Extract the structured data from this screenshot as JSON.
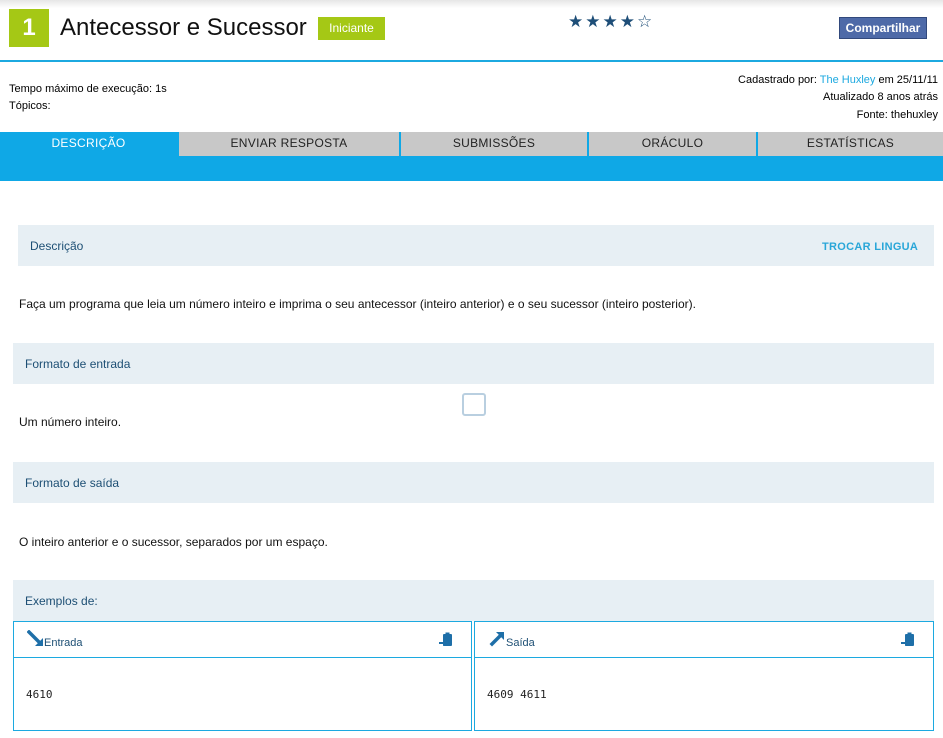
{
  "header": {
    "number": "1",
    "title": "Antecessor e Sucessor",
    "level": "Iniciante",
    "stars": "★★★★☆",
    "share_label": "Compartilhar"
  },
  "meta": {
    "time_limit": "Tempo máximo de execução: 1s",
    "topics": "Tópicos:",
    "registered_prefix": "Cadastrado por: ",
    "registered_by": "The Huxley",
    "registered_date": " em 25/11/11",
    "updated": "Atualizado 8 anos atrás",
    "source": "Fonte: thehuxley"
  },
  "tabs": [
    {
      "label": "DESCRIÇÃO",
      "active": true
    },
    {
      "label": "ENVIAR RESPOSTA",
      "active": false
    },
    {
      "label": "SUBMISSÕES",
      "active": false
    },
    {
      "label": "ORÁCULO",
      "active": false
    },
    {
      "label": "ESTATÍSTICAS",
      "active": false
    }
  ],
  "description": {
    "title": "Descrição",
    "switch_language": "TROCAR LINGUA",
    "text": "Faça um programa que leia um número inteiro e imprima o seu antecessor (inteiro anterior) e o seu sucessor (inteiro posterior)."
  },
  "input_format": {
    "title": "Formato de entrada",
    "text": "Um número inteiro."
  },
  "output_format": {
    "title": "Formato de saída",
    "text": "O inteiro anterior e o sucessor, separados por um espaço."
  },
  "examples": {
    "title": "Exemplos de:",
    "input_label": "Entrada",
    "output_label": "Saída",
    "input_value": "4610",
    "output_value": "4609 4611"
  },
  "colors": {
    "accent_blue": "#0fa8e6",
    "level_green": "#a5c815",
    "section_bg": "#e7eff4",
    "section_text": "#1d4f74"
  }
}
